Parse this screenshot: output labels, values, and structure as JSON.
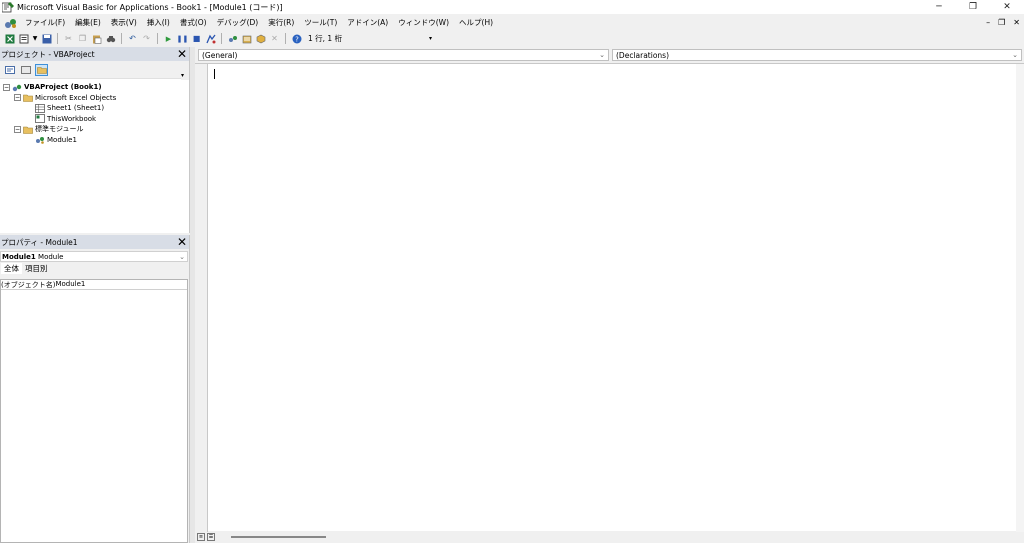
{
  "window": {
    "title": "Microsoft Visual Basic for Applications - Book1 - [Module1 (コード)]",
    "controls": [
      "minimize-icon",
      "restore-icon",
      "close-icon"
    ]
  },
  "menubar": {
    "items": [
      "ファイル(F)",
      "編集(E)",
      "表示(V)",
      "挿入(I)",
      "書式(O)",
      "デバッグ(D)",
      "実行(R)",
      "ツール(T)",
      "アドイン(A)",
      "ウィンドウ(W)",
      "ヘルプ(H)"
    ]
  },
  "toolbar": {
    "position": "1 行, 1 桁"
  },
  "project_pane": {
    "title": "プロジェクト - VBAProject",
    "tree": {
      "root": "VBAProject (Book1)",
      "excel_objects": "Microsoft Excel Objects",
      "sheet1": "Sheet1 (Sheet1)",
      "thisworkbook": "ThisWorkbook",
      "std_modules": "標準モジュール",
      "module1": "Module1"
    }
  },
  "properties_pane": {
    "title": "プロパティ - Module1",
    "object_name": "Module1",
    "object_type": "Module",
    "tabs": [
      "全体",
      "項目別"
    ],
    "rows": [
      {
        "name": "(オブジェクト名)",
        "value": "Module1"
      }
    ]
  },
  "code_window": {
    "object_combo": "(General)",
    "proc_combo": "(Declarations)"
  },
  "colors": {
    "pane_header": "#d8dde6",
    "selected_button": "#cce4f7"
  }
}
